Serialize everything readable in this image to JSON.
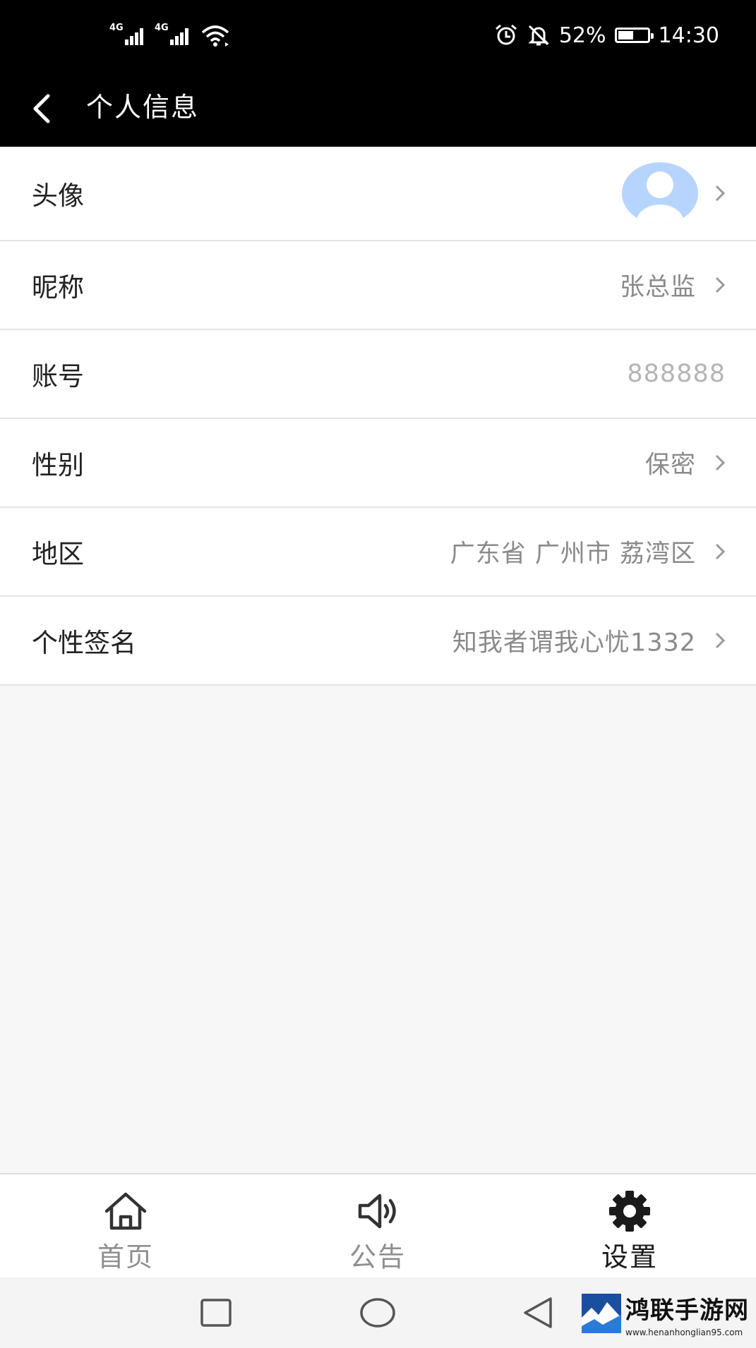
{
  "status_bar": {
    "signal_1_label": "4G",
    "signal_2_label": "4G",
    "battery_percent": "52%",
    "battery_level": 0.52,
    "time": "14:30",
    "icons": [
      "signal-icon",
      "wifi-icon",
      "alarm-icon",
      "mute-bell-icon",
      "battery-icon"
    ]
  },
  "header": {
    "title": "个人信息",
    "back_icon": "chevron-left-icon"
  },
  "profile_rows": [
    {
      "label": "头像",
      "value": ""
    },
    {
      "label": "昵称",
      "value": "张总监"
    },
    {
      "label": "账号",
      "value": "888888"
    },
    {
      "label": "性别",
      "value": "保密"
    },
    {
      "label": "地区",
      "value": "广东省 广州市 荔湾区"
    },
    {
      "label": "个性签名",
      "value": "知我者谓我心忧1332"
    }
  ],
  "tabs": [
    {
      "label": "首页",
      "icon": "home-icon",
      "active": false
    },
    {
      "label": "公告",
      "icon": "speaker-icon",
      "active": false
    },
    {
      "label": "设置",
      "icon": "gear-icon",
      "active": true
    }
  ],
  "system_nav": {
    "icons": [
      "recent-apps-icon",
      "home-circle-icon",
      "back-triangle-icon"
    ]
  },
  "watermark": {
    "title": "鸿联手游网",
    "url": "www.henanhonglian95.com"
  },
  "colors": {
    "header_bg": "#000000",
    "page_bg": "#f7f7f7",
    "avatar_blue": "#b7d4ff",
    "value_gray": "#8a8a8a",
    "active_tab": "#1a1a1a"
  }
}
